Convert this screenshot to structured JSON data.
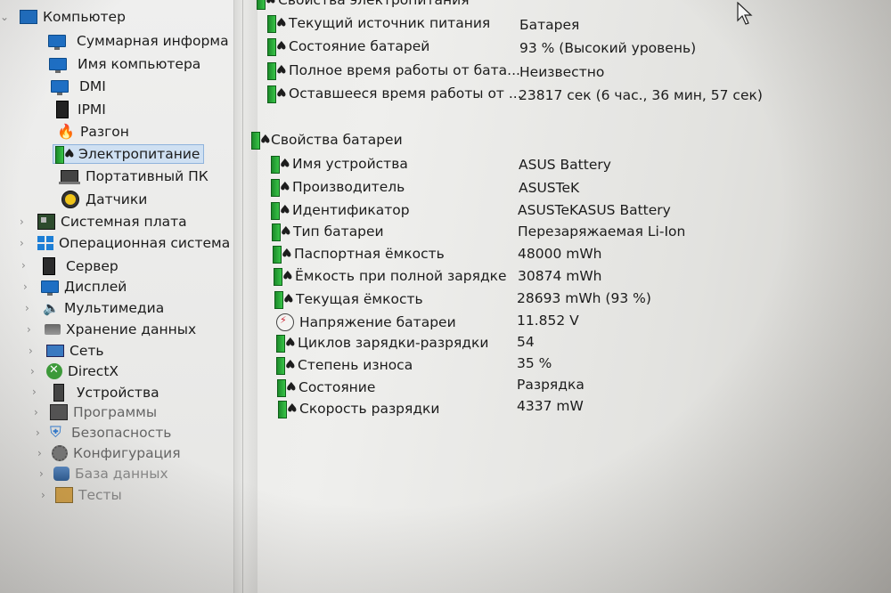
{
  "tree": {
    "root": {
      "label": "Компьютер",
      "icon": "computer-icon"
    },
    "children": [
      {
        "label": "Суммарная информа",
        "icon": "monitor-icon"
      },
      {
        "label": "Имя компьютера",
        "icon": "monitor-icon"
      },
      {
        "label": "DMI",
        "icon": "monitor-icon"
      },
      {
        "label": "IPMI",
        "icon": "chip-icon"
      },
      {
        "label": "Разгон",
        "icon": "fire-icon"
      },
      {
        "label": "Электропитание",
        "icon": "battery-icon",
        "selected": true
      },
      {
        "label": "Портативный ПК",
        "icon": "laptop-icon"
      },
      {
        "label": "Датчики",
        "icon": "gauge-icon"
      }
    ],
    "sections": [
      {
        "label": "Системная плата",
        "icon": "motherboard-icon"
      },
      {
        "label": "Операционная система",
        "icon": "windows-icon"
      },
      {
        "label": "Сервер",
        "icon": "server-icon"
      },
      {
        "label": "Дисплей",
        "icon": "display-icon"
      },
      {
        "label": "Мультимедиа",
        "icon": "multimedia-icon"
      },
      {
        "label": "Хранение данных",
        "icon": "storage-icon"
      },
      {
        "label": "Сеть",
        "icon": "network-icon"
      },
      {
        "label": "DirectX",
        "icon": "directx-icon"
      },
      {
        "label": "Устройства",
        "icon": "devices-icon"
      },
      {
        "label": "Программы",
        "icon": "programs-icon"
      },
      {
        "label": "Безопасность",
        "icon": "security-icon"
      },
      {
        "label": "Конфигурация",
        "icon": "config-icon"
      },
      {
        "label": "База данных",
        "icon": "database-icon"
      },
      {
        "label": "Тесты",
        "icon": "tests-icon"
      }
    ]
  },
  "power": {
    "title": "Свойства электропитания",
    "items": [
      {
        "name": "Текущий источник питания",
        "value": "Батарея"
      },
      {
        "name": "Состояние батарей",
        "value": "93 % (Высокий уровень)"
      },
      {
        "name": "Полное время работы от бата...",
        "value": "Неизвестно"
      },
      {
        "name": "Оставшееся время работы от ...",
        "value": "23817 сек (6 час., 36 мин, 57 сек)"
      }
    ]
  },
  "battery": {
    "title": "Свойства батареи",
    "items": [
      {
        "name": "Имя устройства",
        "value": "ASUS Battery",
        "icon": "battery-icon"
      },
      {
        "name": "Производитель",
        "value": "ASUSTeK",
        "icon": "battery-icon"
      },
      {
        "name": "Идентификатор",
        "value": "ASUSTeKASUS Battery",
        "icon": "battery-icon"
      },
      {
        "name": "Тип батареи",
        "value": "Перезаряжаемая Li-Ion",
        "icon": "battery-icon"
      },
      {
        "name": "Паспортная ёмкость",
        "value": "48000 mWh",
        "icon": "battery-icon"
      },
      {
        "name": "Ёмкость при полной зарядке",
        "value": "30874 mWh",
        "icon": "battery-icon"
      },
      {
        "name": "Текущая ёмкость",
        "value": "28693 mWh  (93 %)",
        "icon": "battery-icon"
      },
      {
        "name": "Напряжение батареи",
        "value": "11.852 V",
        "icon": "voltage-icon"
      },
      {
        "name": "Циклов зарядки-разрядки",
        "value": "54",
        "icon": "battery-icon"
      },
      {
        "name": "Степень износа",
        "value": "35 %",
        "icon": "battery-icon"
      },
      {
        "name": "Состояние",
        "value": "Разрядка",
        "icon": "battery-icon"
      },
      {
        "name": "Скорость разрядки",
        "value": "4337 mW",
        "icon": "battery-icon"
      }
    ]
  }
}
